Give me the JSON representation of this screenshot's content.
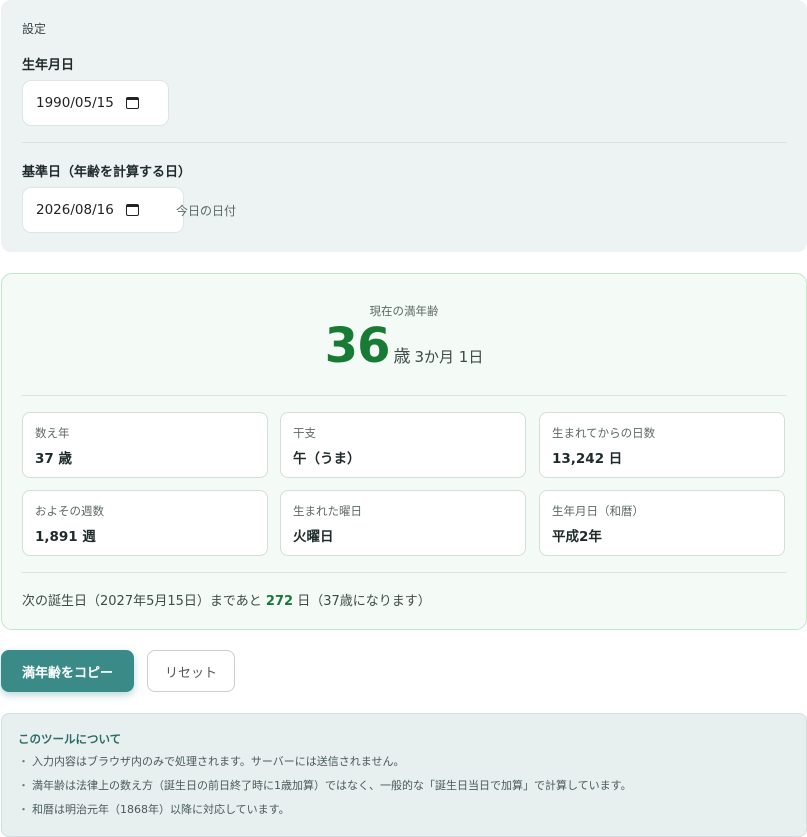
{
  "settings": {
    "section_label": "設定",
    "birthdate_label": "生年月日",
    "birthdate_value": "1990/05/15",
    "basedate_label": "基準日（年齢を計算する日）",
    "basedate_value": "2026/08/16",
    "basedate_hint": "今日の日付"
  },
  "result": {
    "caption": "現在の満年齢",
    "age": "36",
    "age_unit": "歳",
    "age_detail": "3か月 1日",
    "cards": [
      {
        "label": "数え年",
        "value": "37 歳"
      },
      {
        "label": "干支",
        "value": "午（うま）"
      },
      {
        "label": "生まれてからの日数",
        "value": "13,242 日"
      },
      {
        "label": "およその週数",
        "value": "1,891 週"
      },
      {
        "label": "生まれた曜日",
        "value": "火曜日"
      },
      {
        "label": "生年月日（和暦）",
        "value": "平成2年"
      }
    ],
    "next_birthday_prefix": "次の誕生日（2027年5月15日）まであと",
    "next_birthday_days": "272",
    "next_birthday_suffix": "日（37歳になります）"
  },
  "actions": {
    "copy_label": "満年齢をコピー",
    "reset_label": "リセット"
  },
  "about": {
    "title": "このツールについて",
    "items": [
      "入力内容はブラウザ内のみで処理されます。サーバーには送信されません。",
      "満年齢は法律上の数え方（誕生日の前日終了時に1歳加算）ではなく、一般的な「誕生日当日で加算」で計算しています。",
      "和暦は明治元年（1868年）以降に対応しています。"
    ]
  },
  "colors": {
    "accent_green": "#177a35",
    "button_teal": "#3a8b88",
    "settings_bg": "#edf2f2",
    "result_bg": "#f4fbf6"
  },
  "icons": {
    "date_picker": "calendar-icon"
  }
}
